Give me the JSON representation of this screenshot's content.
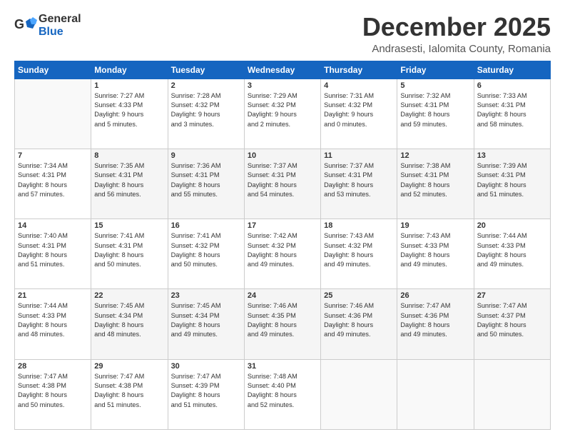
{
  "header": {
    "logo_general": "General",
    "logo_blue": "Blue",
    "month_title": "December 2025",
    "location": "Andrasesti, Ialomita County, Romania"
  },
  "weekdays": [
    "Sunday",
    "Monday",
    "Tuesday",
    "Wednesday",
    "Thursday",
    "Friday",
    "Saturday"
  ],
  "weeks": [
    [
      {
        "day": "",
        "info": ""
      },
      {
        "day": "1",
        "info": "Sunrise: 7:27 AM\nSunset: 4:33 PM\nDaylight: 9 hours\nand 5 minutes."
      },
      {
        "day": "2",
        "info": "Sunrise: 7:28 AM\nSunset: 4:32 PM\nDaylight: 9 hours\nand 3 minutes."
      },
      {
        "day": "3",
        "info": "Sunrise: 7:29 AM\nSunset: 4:32 PM\nDaylight: 9 hours\nand 2 minutes."
      },
      {
        "day": "4",
        "info": "Sunrise: 7:31 AM\nSunset: 4:32 PM\nDaylight: 9 hours\nand 0 minutes."
      },
      {
        "day": "5",
        "info": "Sunrise: 7:32 AM\nSunset: 4:31 PM\nDaylight: 8 hours\nand 59 minutes."
      },
      {
        "day": "6",
        "info": "Sunrise: 7:33 AM\nSunset: 4:31 PM\nDaylight: 8 hours\nand 58 minutes."
      }
    ],
    [
      {
        "day": "7",
        "info": "Sunrise: 7:34 AM\nSunset: 4:31 PM\nDaylight: 8 hours\nand 57 minutes."
      },
      {
        "day": "8",
        "info": "Sunrise: 7:35 AM\nSunset: 4:31 PM\nDaylight: 8 hours\nand 56 minutes."
      },
      {
        "day": "9",
        "info": "Sunrise: 7:36 AM\nSunset: 4:31 PM\nDaylight: 8 hours\nand 55 minutes."
      },
      {
        "day": "10",
        "info": "Sunrise: 7:37 AM\nSunset: 4:31 PM\nDaylight: 8 hours\nand 54 minutes."
      },
      {
        "day": "11",
        "info": "Sunrise: 7:37 AM\nSunset: 4:31 PM\nDaylight: 8 hours\nand 53 minutes."
      },
      {
        "day": "12",
        "info": "Sunrise: 7:38 AM\nSunset: 4:31 PM\nDaylight: 8 hours\nand 52 minutes."
      },
      {
        "day": "13",
        "info": "Sunrise: 7:39 AM\nSunset: 4:31 PM\nDaylight: 8 hours\nand 51 minutes."
      }
    ],
    [
      {
        "day": "14",
        "info": "Sunrise: 7:40 AM\nSunset: 4:31 PM\nDaylight: 8 hours\nand 51 minutes."
      },
      {
        "day": "15",
        "info": "Sunrise: 7:41 AM\nSunset: 4:31 PM\nDaylight: 8 hours\nand 50 minutes."
      },
      {
        "day": "16",
        "info": "Sunrise: 7:41 AM\nSunset: 4:32 PM\nDaylight: 8 hours\nand 50 minutes."
      },
      {
        "day": "17",
        "info": "Sunrise: 7:42 AM\nSunset: 4:32 PM\nDaylight: 8 hours\nand 49 minutes."
      },
      {
        "day": "18",
        "info": "Sunrise: 7:43 AM\nSunset: 4:32 PM\nDaylight: 8 hours\nand 49 minutes."
      },
      {
        "day": "19",
        "info": "Sunrise: 7:43 AM\nSunset: 4:33 PM\nDaylight: 8 hours\nand 49 minutes."
      },
      {
        "day": "20",
        "info": "Sunrise: 7:44 AM\nSunset: 4:33 PM\nDaylight: 8 hours\nand 49 minutes."
      }
    ],
    [
      {
        "day": "21",
        "info": "Sunrise: 7:44 AM\nSunset: 4:33 PM\nDaylight: 8 hours\nand 48 minutes."
      },
      {
        "day": "22",
        "info": "Sunrise: 7:45 AM\nSunset: 4:34 PM\nDaylight: 8 hours\nand 48 minutes."
      },
      {
        "day": "23",
        "info": "Sunrise: 7:45 AM\nSunset: 4:34 PM\nDaylight: 8 hours\nand 49 minutes."
      },
      {
        "day": "24",
        "info": "Sunrise: 7:46 AM\nSunset: 4:35 PM\nDaylight: 8 hours\nand 49 minutes."
      },
      {
        "day": "25",
        "info": "Sunrise: 7:46 AM\nSunset: 4:36 PM\nDaylight: 8 hours\nand 49 minutes."
      },
      {
        "day": "26",
        "info": "Sunrise: 7:47 AM\nSunset: 4:36 PM\nDaylight: 8 hours\nand 49 minutes."
      },
      {
        "day": "27",
        "info": "Sunrise: 7:47 AM\nSunset: 4:37 PM\nDaylight: 8 hours\nand 50 minutes."
      }
    ],
    [
      {
        "day": "28",
        "info": "Sunrise: 7:47 AM\nSunset: 4:38 PM\nDaylight: 8 hours\nand 50 minutes."
      },
      {
        "day": "29",
        "info": "Sunrise: 7:47 AM\nSunset: 4:38 PM\nDaylight: 8 hours\nand 51 minutes."
      },
      {
        "day": "30",
        "info": "Sunrise: 7:47 AM\nSunset: 4:39 PM\nDaylight: 8 hours\nand 51 minutes."
      },
      {
        "day": "31",
        "info": "Sunrise: 7:48 AM\nSunset: 4:40 PM\nDaylight: 8 hours\nand 52 minutes."
      },
      {
        "day": "",
        "info": ""
      },
      {
        "day": "",
        "info": ""
      },
      {
        "day": "",
        "info": ""
      }
    ]
  ]
}
